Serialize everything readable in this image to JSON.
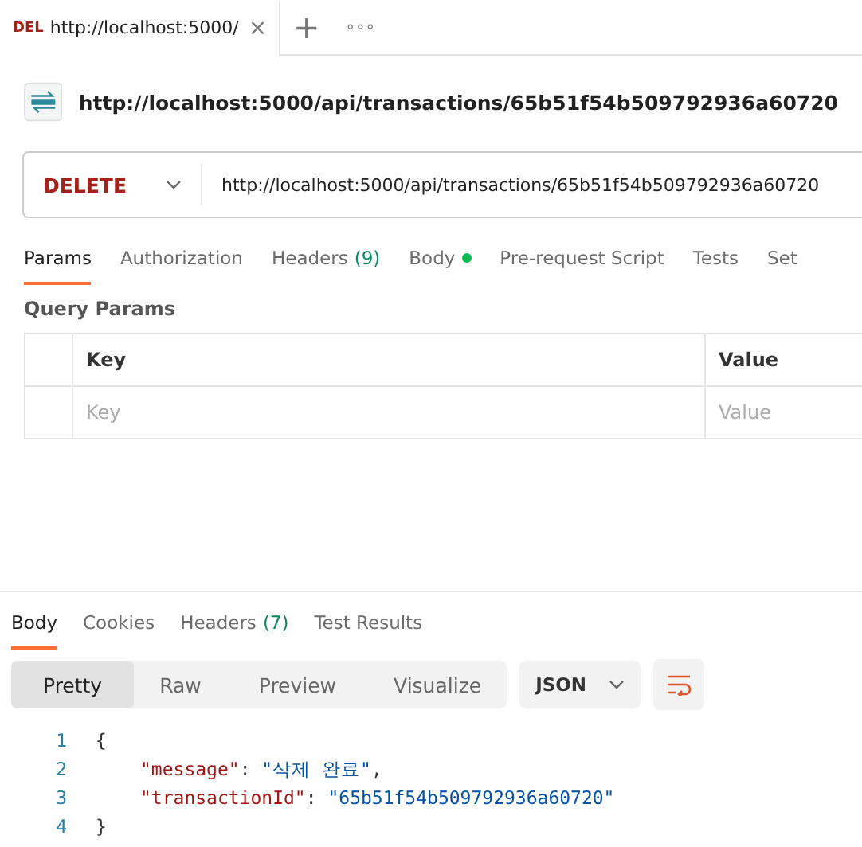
{
  "request_tab": {
    "method": "DEL",
    "title": "http://localhost:5000/",
    "close": "×",
    "add": "+",
    "more": "∘∘∘"
  },
  "request_name": "http://localhost:5000/api/transactions/65b51f54b509792936a60720",
  "url_bar": {
    "method": "DELETE",
    "url": "http://localhost:5000/api/transactions/65b51f54b509792936a60720"
  },
  "request_tabs": [
    {
      "label": "Params",
      "selected": true
    },
    {
      "label": "Authorization",
      "selected": false
    },
    {
      "label": "Headers",
      "count": "(9)",
      "selected": false
    },
    {
      "label": "Body",
      "has_dot": true,
      "selected": false
    },
    {
      "label": "Pre-request Script",
      "selected": false
    },
    {
      "label": "Tests",
      "selected": false
    },
    {
      "label": "Set",
      "selected": false
    }
  ],
  "query_params": {
    "title": "Query Params",
    "columns": [
      "Key",
      "Value"
    ],
    "placeholders": [
      "Key",
      "Value"
    ]
  },
  "response_tabs": [
    {
      "label": "Body",
      "selected": true
    },
    {
      "label": "Cookies",
      "selected": false
    },
    {
      "label": "Headers",
      "count": "(7)",
      "selected": false
    },
    {
      "label": "Test Results",
      "selected": false
    }
  ],
  "view_modes": [
    {
      "label": "Pretty",
      "selected": true
    },
    {
      "label": "Raw",
      "selected": false
    },
    {
      "label": "Preview",
      "selected": false
    },
    {
      "label": "Visualize",
      "selected": false
    }
  ],
  "format": "JSON",
  "code_lines": [
    {
      "number": "1",
      "tokens": [
        {
          "kind": "brace",
          "text": "{"
        }
      ]
    },
    {
      "number": "2",
      "tokens": [
        {
          "kind": "key",
          "text": "\"message\""
        },
        {
          "kind": "punct",
          "text": ": "
        },
        {
          "kind": "string",
          "text": "\"삭제 완료\""
        },
        {
          "kind": "punct",
          "text": ","
        }
      ]
    },
    {
      "number": "3",
      "tokens": [
        {
          "kind": "key",
          "text": "\"transactionId\""
        },
        {
          "kind": "punct",
          "text": ": "
        },
        {
          "kind": "string",
          "text": "\"65b51f54b509792936a60720\""
        }
      ]
    },
    {
      "number": "4",
      "tokens": [
        {
          "kind": "brace",
          "text": "}"
        }
      ]
    }
  ]
}
